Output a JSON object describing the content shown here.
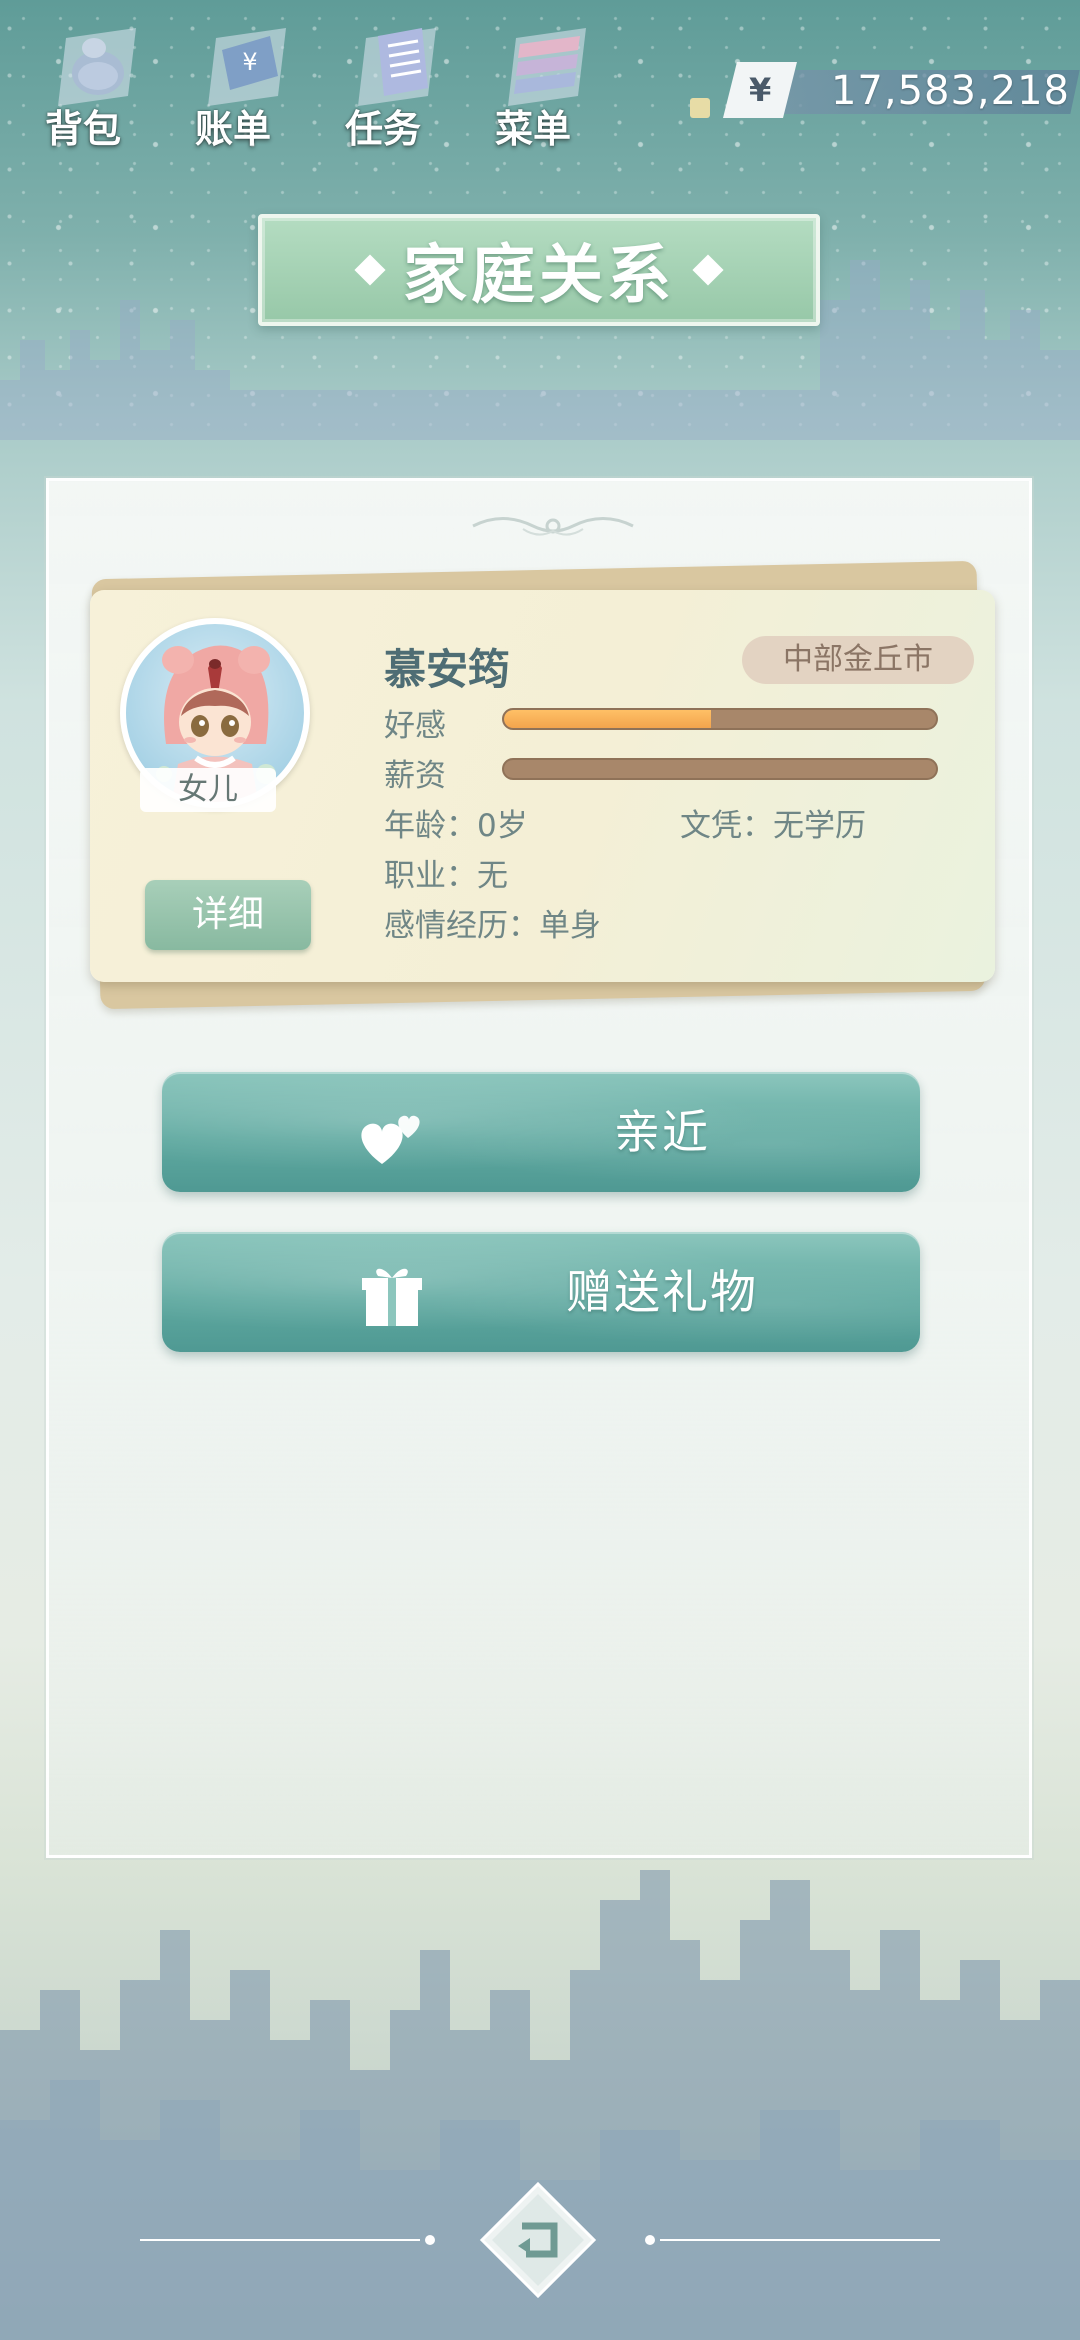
{
  "top_nav": {
    "items": [
      {
        "label": "背包",
        "icon": "backpack-icon"
      },
      {
        "label": "账单",
        "icon": "bill-icon"
      },
      {
        "label": "任务",
        "icon": "task-icon"
      },
      {
        "label": "菜单",
        "icon": "menu-icon"
      }
    ]
  },
  "currency": {
    "symbol": "¥",
    "amount": "17,583,218"
  },
  "page": {
    "title": "家庭关系"
  },
  "profile": {
    "name": "慕安筠",
    "relation": "女儿",
    "location": "中部金丘市",
    "detail_button": "详细",
    "affection_label": "好感",
    "affection_fraction": 0.48,
    "salary_label": "薪资",
    "salary_fraction": 0.0,
    "age_label": "年龄：",
    "age_value": "0岁",
    "education_label": "文凭：",
    "education_value": "无学历",
    "job_label": "职业：",
    "job_value": "无",
    "romance_label": "感情经历：",
    "romance_value": "单身"
  },
  "actions": {
    "approach_label": "亲近",
    "gift_label": "赠送礼物"
  },
  "colors": {
    "banner": "#a4d1b3",
    "action_button": "#5fa9a0",
    "affection_bar": "#f3a44d",
    "bar_track": "#a8876a",
    "text_main": "#4e6d74"
  }
}
